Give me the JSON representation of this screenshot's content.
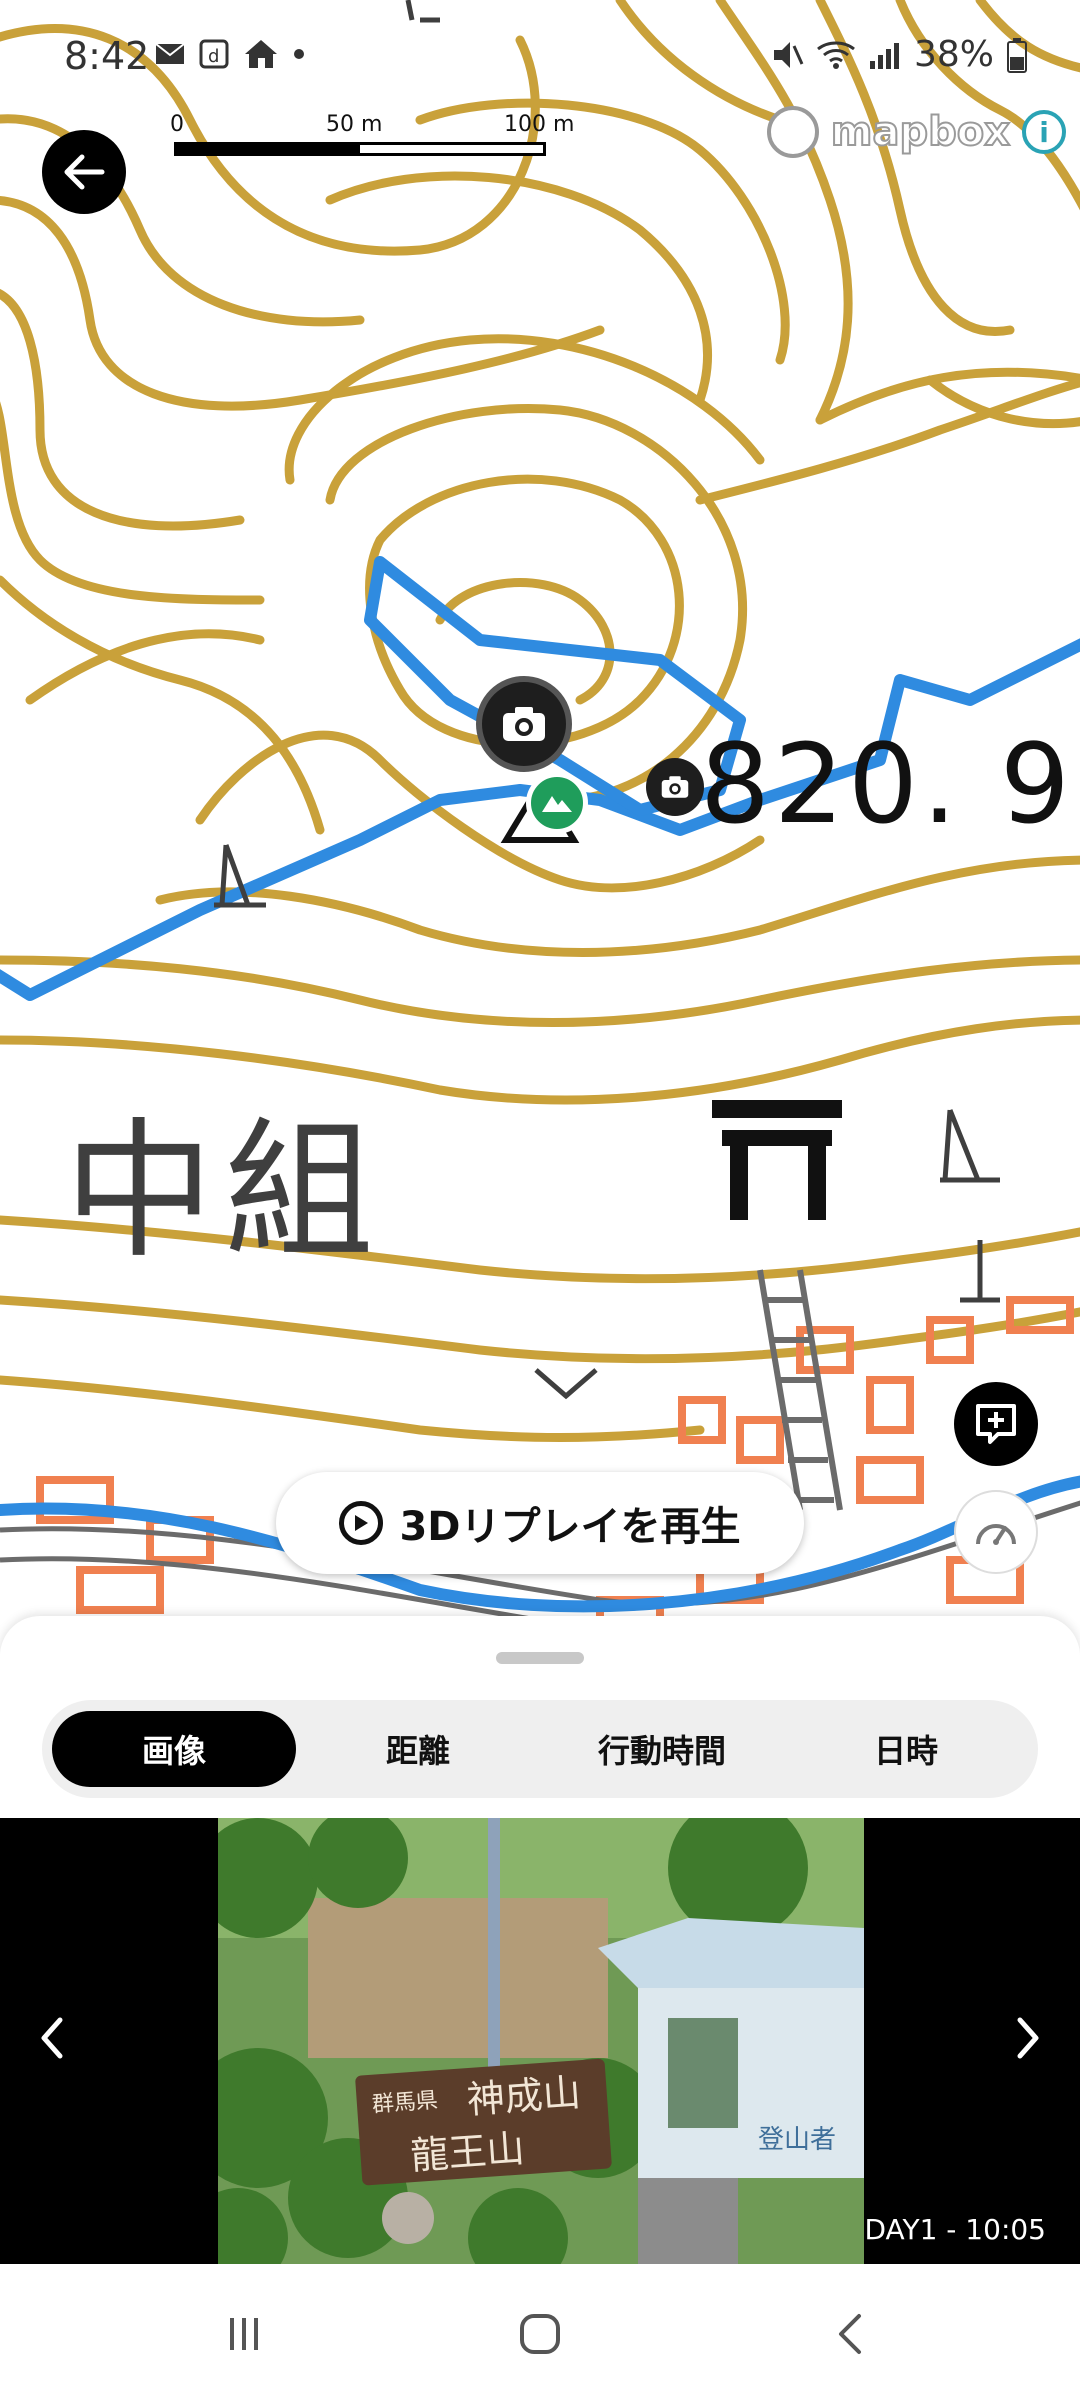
{
  "status_bar": {
    "time": "8:42",
    "battery": "38%",
    "left_icons": [
      "mail-icon",
      "docomo-icon",
      "home-icon",
      "dot-icon"
    ],
    "right_icons": [
      "mute-icon",
      "wifi-icon",
      "signal-icon",
      "battery-icon"
    ]
  },
  "map": {
    "scale": {
      "zero": "0",
      "mid": "50 m",
      "max": "100 m"
    },
    "attribution": "mapbox",
    "elevation_label": "820. 9",
    "place_label": "中組",
    "colors": {
      "contour": "#c9a13a",
      "route": "#2f8be0",
      "building": "#f08050",
      "road": "#6b6b6b"
    }
  },
  "buttons": {
    "replay": "3Dリプレイを再生"
  },
  "tabs": [
    {
      "label": "画像",
      "active": true
    },
    {
      "label": "距離",
      "active": false
    },
    {
      "label": "行動時間",
      "active": false
    },
    {
      "label": "日時",
      "active": false
    }
  ],
  "photo": {
    "caption": "DAY1 - 10:05",
    "sign_text_1": "群馬県",
    "sign_text_2": "神成山",
    "sign_text_3": "龍王山",
    "box_label": "登山者"
  }
}
